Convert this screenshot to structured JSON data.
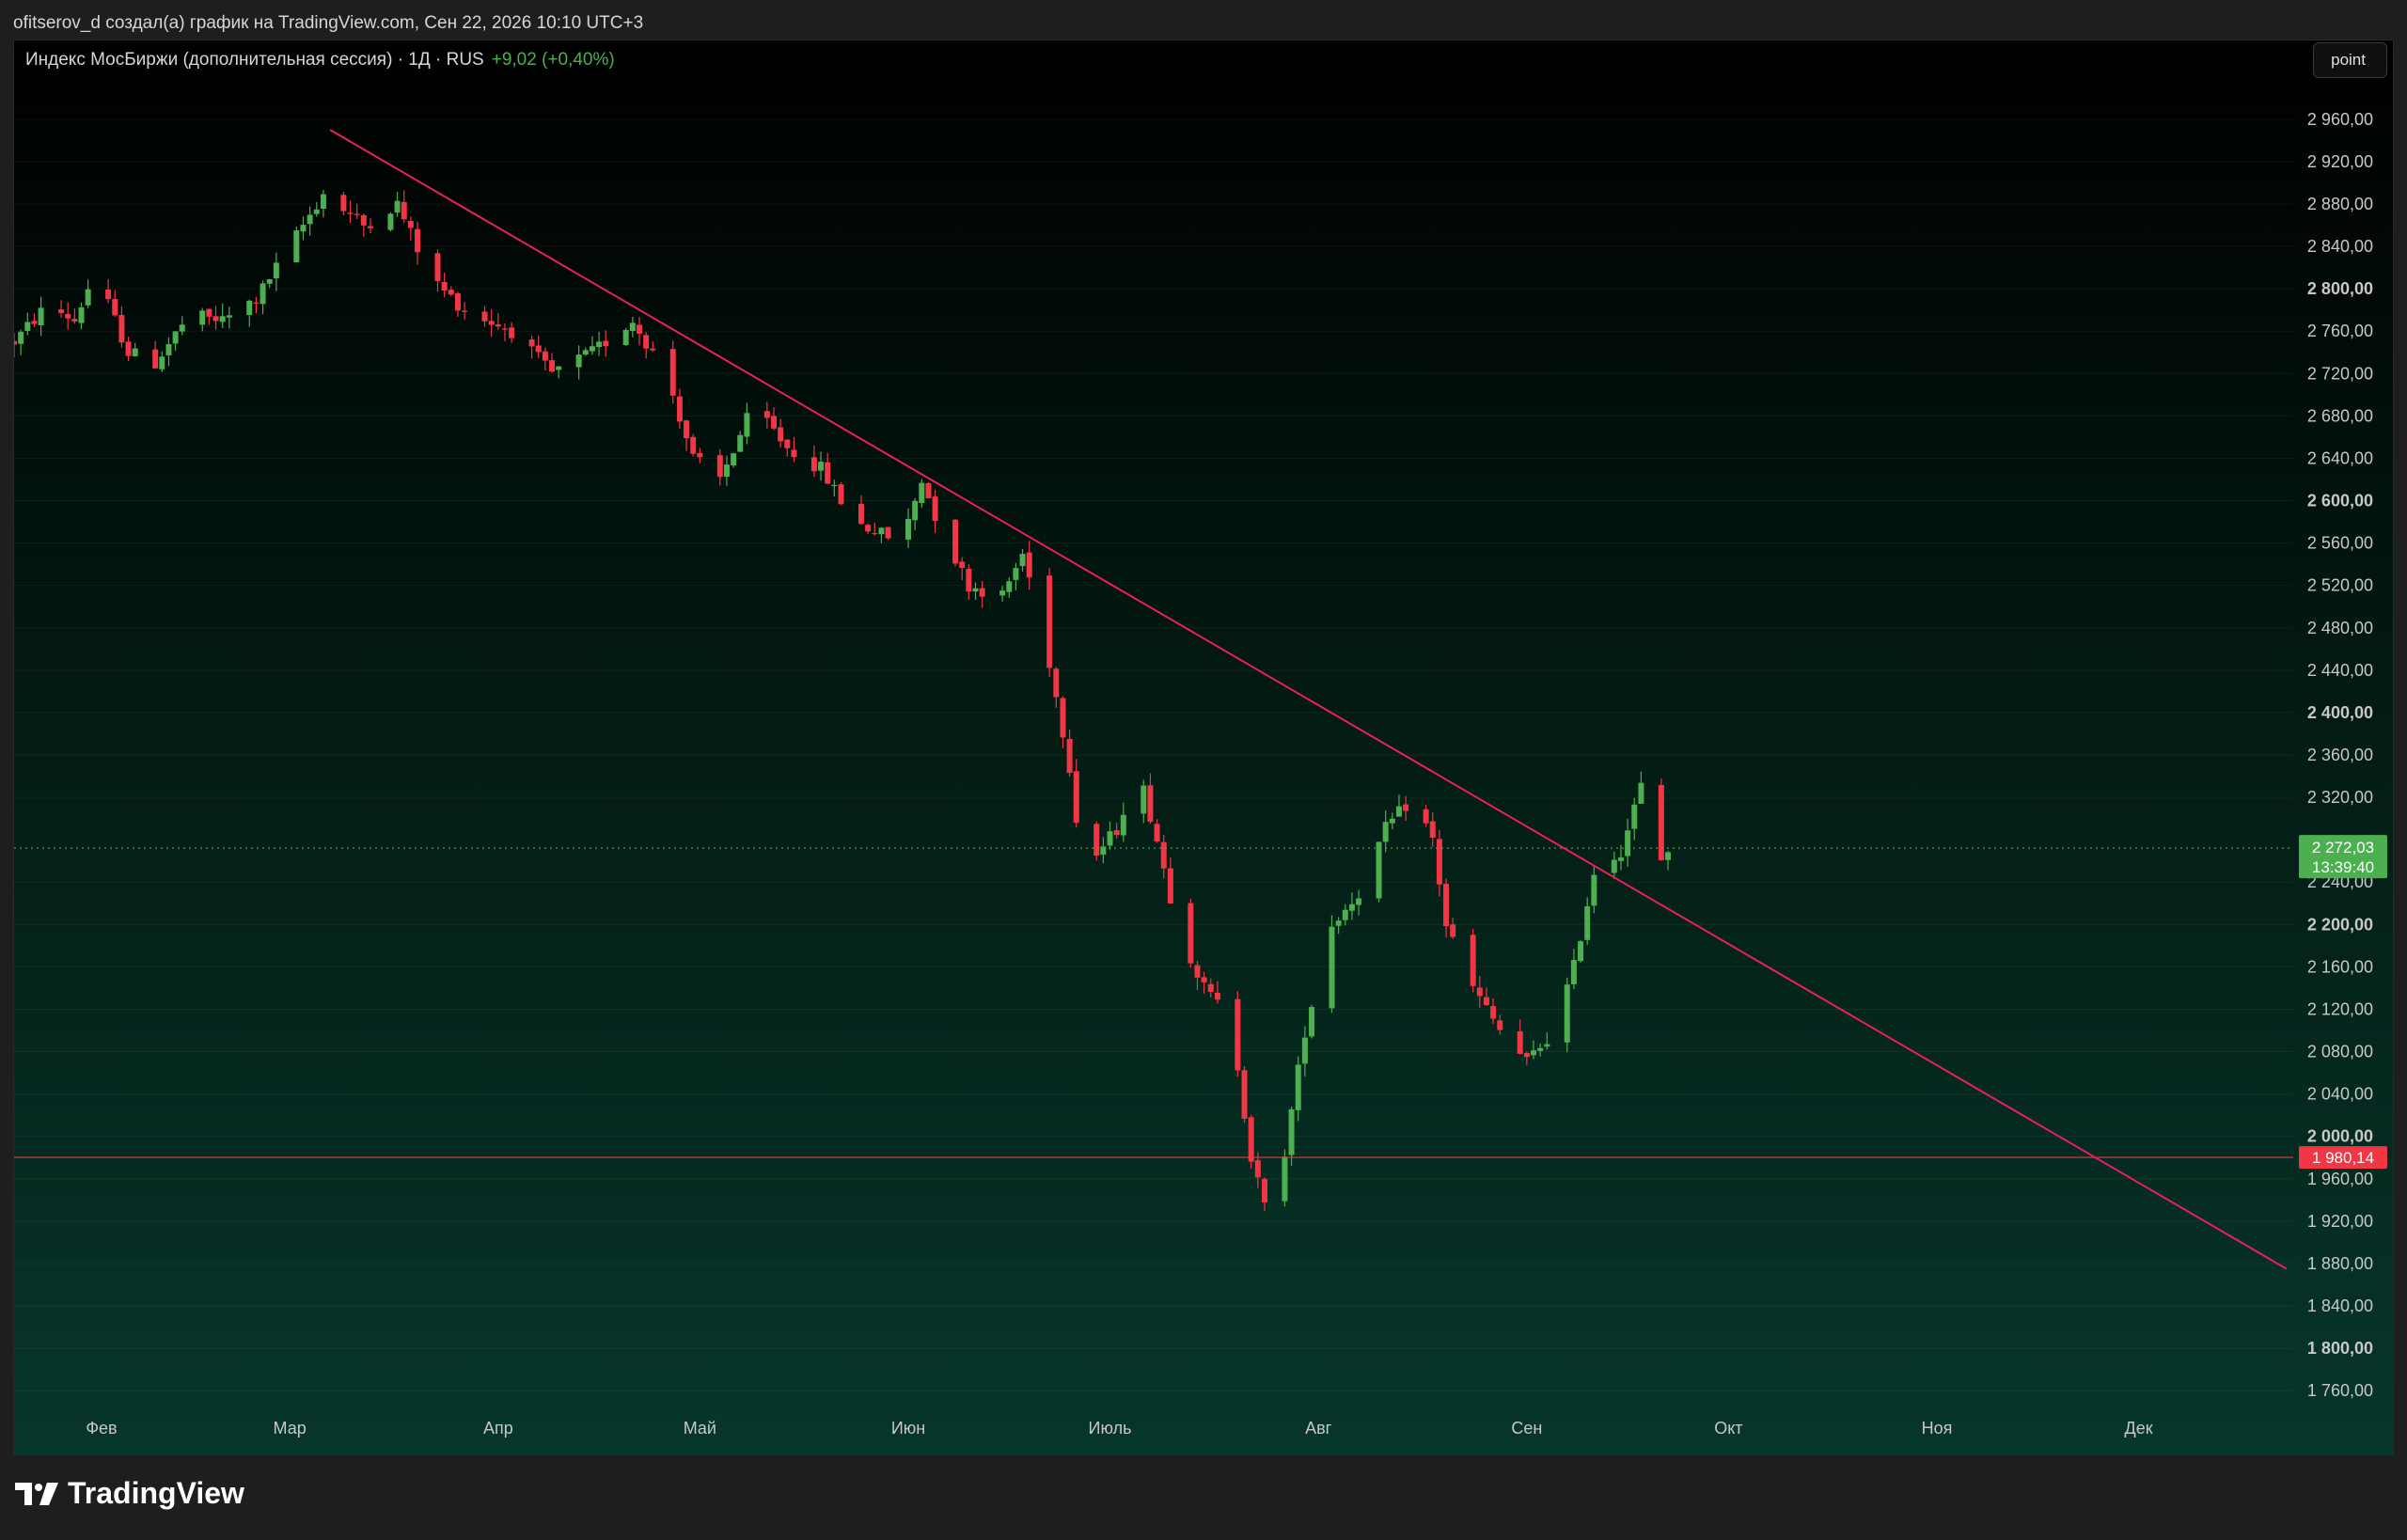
{
  "header": {
    "caption": "ofitserov_d создал(а) график на TradingView.com, Сен 22, 2026 10:10 UTC+3"
  },
  "legend": {
    "symbol": "Индекс МосБиржи (дополнительная сессия) · 1Д · RUS",
    "change": "+9,02 (+0,40%)"
  },
  "toolbar": {
    "point_label": "point"
  },
  "footer": {
    "brand": "TradingView"
  },
  "colors": {
    "up": "#4caf50",
    "down": "#f23645",
    "trendline": "#e91e63",
    "level": "#f23645"
  },
  "chart_data": {
    "type": "candlestick",
    "title": "",
    "xlabel": "",
    "ylabel": "",
    "ylim": [
      1730,
      2990
    ],
    "y_ticks": [
      {
        "value": 2960,
        "label": "2 960,00",
        "bold": false
      },
      {
        "value": 2920,
        "label": "2 920,00",
        "bold": false
      },
      {
        "value": 2880,
        "label": "2 880,00",
        "bold": false
      },
      {
        "value": 2840,
        "label": "2 840,00",
        "bold": false
      },
      {
        "value": 2800,
        "label": "2 800,00",
        "bold": true
      },
      {
        "value": 2760,
        "label": "2 760,00",
        "bold": false
      },
      {
        "value": 2720,
        "label": "2 720,00",
        "bold": false
      },
      {
        "value": 2680,
        "label": "2 680,00",
        "bold": false
      },
      {
        "value": 2640,
        "label": "2 640,00",
        "bold": false
      },
      {
        "value": 2600,
        "label": "2 600,00",
        "bold": true
      },
      {
        "value": 2560,
        "label": "2 560,00",
        "bold": false
      },
      {
        "value": 2520,
        "label": "2 520,00",
        "bold": false
      },
      {
        "value": 2480,
        "label": "2 480,00",
        "bold": false
      },
      {
        "value": 2440,
        "label": "2 440,00",
        "bold": false
      },
      {
        "value": 2400,
        "label": "2 400,00",
        "bold": true
      },
      {
        "value": 2360,
        "label": "2 360,00",
        "bold": false
      },
      {
        "value": 2320,
        "label": "2 320,00",
        "bold": false
      },
      {
        "value": 2240,
        "label": "2 240,00",
        "bold": false
      },
      {
        "value": 2200,
        "label": "2 200,00",
        "bold": true
      },
      {
        "value": 2160,
        "label": "2 160,00",
        "bold": false
      },
      {
        "value": 2120,
        "label": "2 120,00",
        "bold": false
      },
      {
        "value": 2080,
        "label": "2 080,00",
        "bold": false
      },
      {
        "value": 2040,
        "label": "2 040,00",
        "bold": false
      },
      {
        "value": 2000,
        "label": "2 000,00",
        "bold": true
      },
      {
        "value": 1960,
        "label": "1 960,00",
        "bold": false
      },
      {
        "value": 1920,
        "label": "1 920,00",
        "bold": false
      },
      {
        "value": 1880,
        "label": "1 880,00",
        "bold": false
      },
      {
        "value": 1840,
        "label": "1 840,00",
        "bold": false
      },
      {
        "value": 1800,
        "label": "1 800,00",
        "bold": true
      },
      {
        "value": 1760,
        "label": "1 760,00",
        "bold": false
      }
    ],
    "months": [
      {
        "label": "Фев",
        "t": "2026-02-01"
      },
      {
        "label": "Мар",
        "t": "2026-03-01"
      },
      {
        "label": "Апр",
        "t": "2026-04-01"
      },
      {
        "label": "Май",
        "t": "2026-05-01"
      },
      {
        "label": "Июн",
        "t": "2026-06-01"
      },
      {
        "label": "Июль",
        "t": "2026-07-01"
      },
      {
        "label": "Авг",
        "t": "2026-08-01"
      },
      {
        "label": "Сен",
        "t": "2026-09-01"
      },
      {
        "label": "Окт",
        "t": "2026-10-01"
      },
      {
        "label": "Ноя",
        "t": "2026-11-01"
      },
      {
        "label": "Дек",
        "t": "2026-12-01"
      }
    ],
    "x_range": [
      "2026-01-19",
      "2026-12-24"
    ],
    "anchors": [
      [
        "2026-01-19",
        2750
      ],
      [
        "2026-01-24",
        2785
      ],
      [
        "2026-01-28",
        2770
      ],
      [
        "2026-01-31",
        2815
      ],
      [
        "2026-02-05",
        2740
      ],
      [
        "2026-02-09",
        2730
      ],
      [
        "2026-02-14",
        2775
      ],
      [
        "2026-02-19",
        2770
      ],
      [
        "2026-02-24",
        2790
      ],
      [
        "2026-02-28",
        2830
      ],
      [
        "2026-03-06",
        2890
      ],
      [
        "2026-03-12",
        2860
      ],
      [
        "2026-03-17",
        2880
      ],
      [
        "2026-03-22",
        2810
      ],
      [
        "2026-03-27",
        2780
      ],
      [
        "2026-04-03",
        2760
      ],
      [
        "2026-04-09",
        2720
      ],
      [
        "2026-04-15",
        2740
      ],
      [
        "2026-04-21",
        2770
      ],
      [
        "2026-04-26",
        2720
      ],
      [
        "2026-04-30",
        2640
      ],
      [
        "2026-05-04",
        2620
      ],
      [
        "2026-05-09",
        2690
      ],
      [
        "2026-05-14",
        2650
      ],
      [
        "2026-05-19",
        2630
      ],
      [
        "2026-05-24",
        2580
      ],
      [
        "2026-05-31",
        2560
      ],
      [
        "2026-06-03",
        2620
      ],
      [
        "2026-06-06",
        2570
      ],
      [
        "2026-06-10",
        2520
      ],
      [
        "2026-06-15",
        2510
      ],
      [
        "2026-06-18",
        2550
      ],
      [
        "2026-06-21",
        2480
      ],
      [
        "2026-06-25",
        2350
      ],
      [
        "2026-06-27",
        2250
      ],
      [
        "2026-07-02",
        2290
      ],
      [
        "2026-07-05",
        2350
      ],
      [
        "2026-07-08",
        2280
      ],
      [
        "2026-07-11",
        2200
      ],
      [
        "2026-07-15",
        2140
      ],
      [
        "2026-07-19",
        2110
      ],
      [
        "2026-07-22",
        1980
      ],
      [
        "2026-07-25",
        1910
      ],
      [
        "2026-07-30",
        2100
      ],
      [
        "2026-08-03",
        2200
      ],
      [
        "2026-08-07",
        2230
      ],
      [
        "2026-08-11",
        2290
      ],
      [
        "2026-08-15",
        2320
      ],
      [
        "2026-08-18",
        2280
      ],
      [
        "2026-08-20",
        2200
      ],
      [
        "2026-08-24",
        2140
      ],
      [
        "2026-08-28",
        2100
      ],
      [
        "2026-09-01",
        2070
      ],
      [
        "2026-09-05",
        2100
      ],
      [
        "2026-09-08",
        2160
      ],
      [
        "2026-09-11",
        2250
      ],
      [
        "2026-09-15",
        2270
      ],
      [
        "2026-09-18",
        2330
      ],
      [
        "2026-09-20",
        2250
      ],
      [
        "2026-09-22",
        2272
      ]
    ],
    "trendline": {
      "start": [
        "2026-03-07",
        2950
      ],
      "end": [
        "2026-12-23",
        1875
      ]
    },
    "current_price": {
      "value": 2272.03,
      "label": "2 272,03",
      "timer": "13:39:40"
    },
    "support_level": {
      "value": 1980.14,
      "label": "1 980,14"
    }
  }
}
